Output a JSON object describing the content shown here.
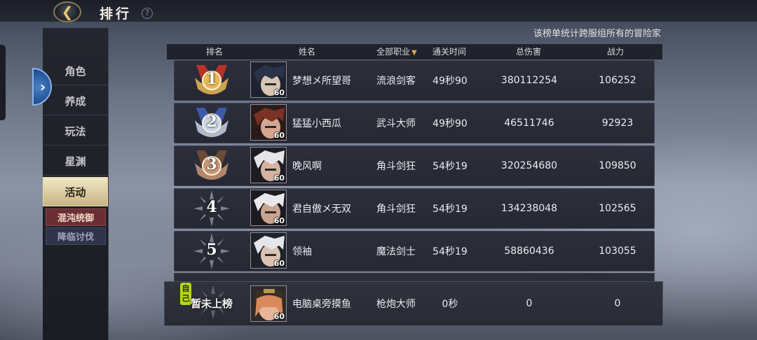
{
  "header": {
    "title": "排行",
    "back_icon": "back-arrow-icon",
    "help_label": "?"
  },
  "sidebar": {
    "expand_icon": "chevron-right-icon",
    "expand_label": "›",
    "items": [
      {
        "label": "角色",
        "active": false
      },
      {
        "label": "养成",
        "active": false
      },
      {
        "label": "玩法",
        "active": false
      },
      {
        "label": "星渊",
        "active": false
      },
      {
        "label": "活动",
        "active": true
      }
    ],
    "sub_items": [
      {
        "label": "混沌统御",
        "active": true
      },
      {
        "label": "降临讨伐",
        "active": false
      }
    ]
  },
  "ranking": {
    "caption": "该榜单统计跨服组所有的冒险家",
    "columns": {
      "rank": "排名",
      "name": "姓名",
      "job": "全部职业",
      "clear_time": "通关时间",
      "damage": "总伤害",
      "power": "战力"
    },
    "job_filter_icon": "dropdown-triangle-icon",
    "rows": [
      {
        "rank": "1",
        "badge": "gold-medal-icon",
        "level": "60",
        "name": "梦想メ所望哥",
        "job": "流浪剑客",
        "time": "49秒90",
        "damage": "380112254",
        "power": "106252"
      },
      {
        "rank": "2",
        "badge": "silver-medal-icon",
        "level": "60",
        "name": "猛猛小西瓜",
        "job": "武斗大师",
        "time": "49秒90",
        "damage": "46511746",
        "power": "92923"
      },
      {
        "rank": "3",
        "badge": "bronze-medal-icon",
        "level": "60",
        "name": "晚风啊",
        "job": "角斗剑狂",
        "time": "54秒19",
        "damage": "320254680",
        "power": "109850"
      },
      {
        "rank": "4",
        "badge": "rank-burst-icon",
        "level": "60",
        "name": "君自傲メ无双",
        "job": "角斗剑狂",
        "time": "54秒19",
        "damage": "134238048",
        "power": "102565"
      },
      {
        "rank": "5",
        "badge": "rank-burst-icon",
        "level": "60",
        "name": "领袖",
        "job": "魔法剑士",
        "time": "54秒19",
        "damage": "58860436",
        "power": "103055"
      }
    ],
    "self": {
      "tag": "自己",
      "rank": "暂未上榜",
      "level": "60",
      "name": "电脑桌旁摸鱼",
      "job": "枪炮大师",
      "time": "0秒",
      "damage": "0",
      "power": "0"
    }
  },
  "colors": {
    "gold": "#d9a74c",
    "active_tab": "#e2d4a3",
    "self_tag": "#b5d21e",
    "sub_active": "#6a2e35"
  }
}
